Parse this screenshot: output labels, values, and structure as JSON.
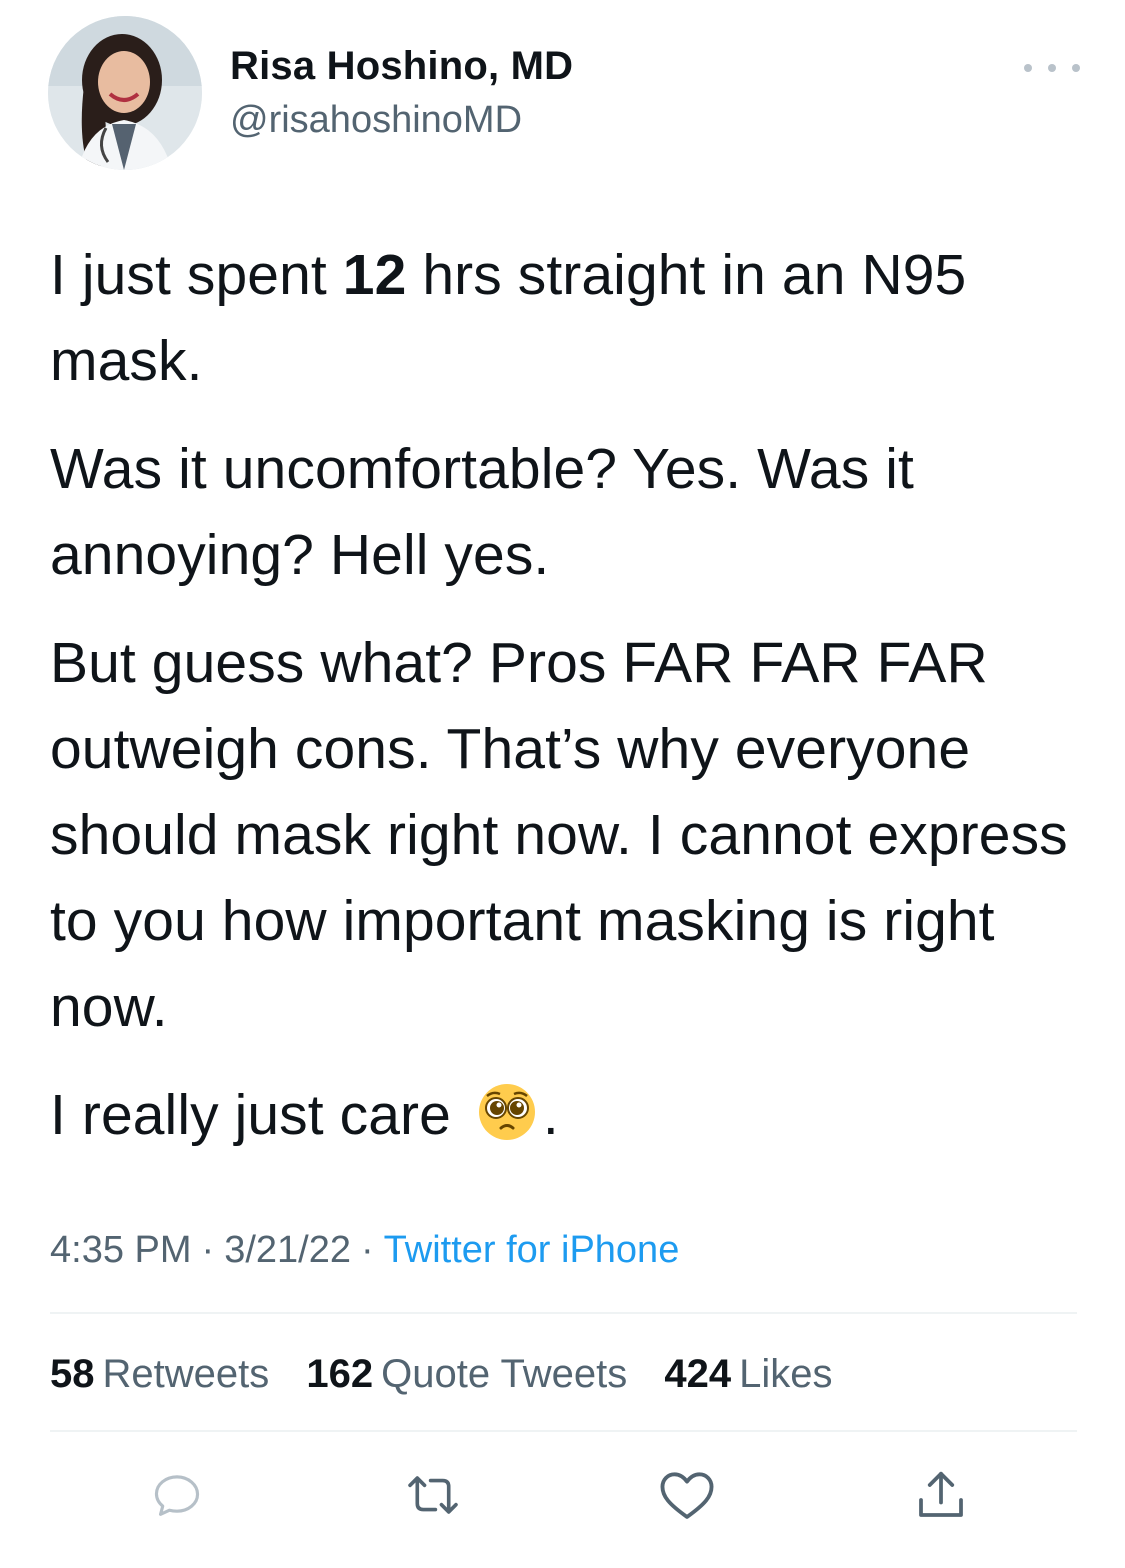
{
  "author": {
    "display_name": "Risa Hoshino, MD",
    "handle": "@risahoshinoMD"
  },
  "tweet": {
    "p1_a": "I just spent ",
    "p1_bold": "12",
    "p1_b": " hrs straight in an N95 mask.",
    "p2": "Was it uncomfortable? Yes. Was it annoying? Hell yes.",
    "p3": "But guess what? Pros FAR FAR FAR outweigh cons. That’s why everyone should mask right now. I cannot express to you how important masking is right now.",
    "p4_a": "I really just care ",
    "p4_emoji": "pleading-face-emoji",
    "p4_b": "."
  },
  "meta": {
    "time": "4:35 PM",
    "date": "3/21/22",
    "separator": "·",
    "source": "Twitter for iPhone"
  },
  "stats": {
    "retweets_count": "58",
    "retweets_label": "Retweets",
    "quotes_count": "162",
    "quotes_label": "Quote Tweets",
    "likes_count": "424",
    "likes_label": "Likes"
  },
  "icons": {
    "more": "more-icon",
    "reply": "reply-icon",
    "retweet": "retweet-icon",
    "like": "heart-icon",
    "share": "share-icon"
  },
  "colors": {
    "text": "#0f1419",
    "secondary": "#536471",
    "link": "#1d9bf0",
    "divider": "#eff3f4"
  }
}
